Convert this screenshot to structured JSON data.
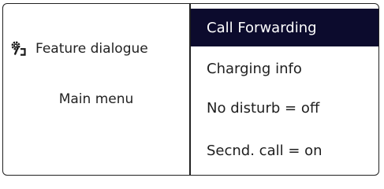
{
  "left_panel": {
    "feature_icon": "feature-dialogue-icon",
    "feature_label": "Feature dialogue",
    "main_menu_label": "Main menu"
  },
  "menu": {
    "items": [
      {
        "label": "Call Forwarding",
        "selected": true
      },
      {
        "label": "Charging info",
        "selected": false
      },
      {
        "label": "No disturb = off",
        "selected": false
      },
      {
        "label": "Secnd. call = on",
        "selected": false
      }
    ]
  },
  "colors": {
    "selected_background": "#0c0b2d",
    "selected_text": "#ffffff",
    "border": "#222222",
    "text": "#1e1e1e"
  }
}
